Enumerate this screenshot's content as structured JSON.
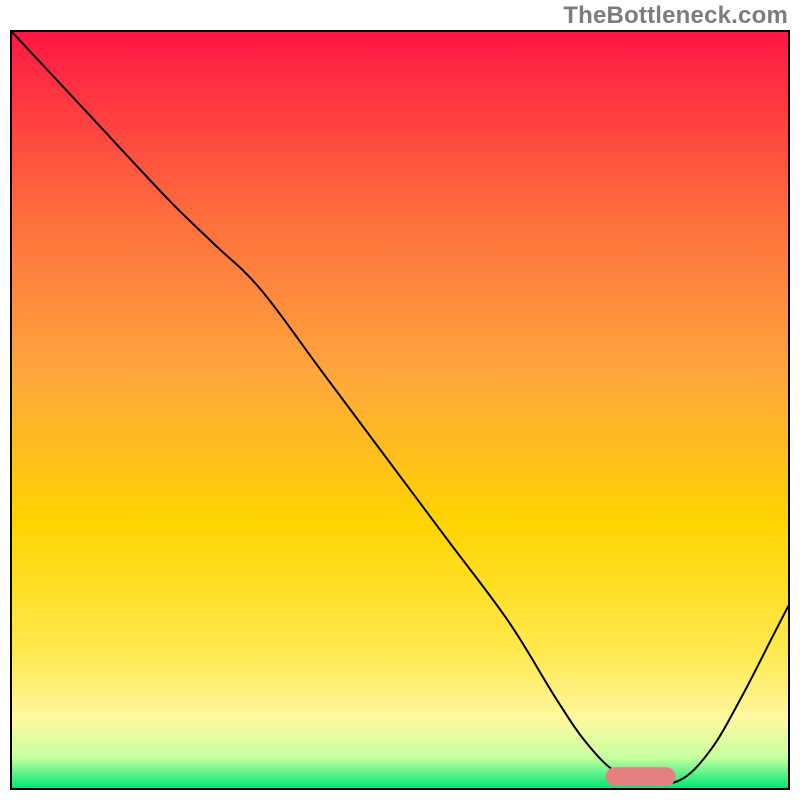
{
  "watermark": "TheBottleneck.com",
  "chart_data": {
    "type": "line",
    "title": "",
    "xlabel": "",
    "ylabel": "",
    "xlim": [
      0,
      100
    ],
    "ylim": [
      0,
      100
    ],
    "grid": false,
    "colors": {
      "gradient_top": "#ff1744",
      "gradient_mid_upper": "#ff8a3d",
      "gradient_mid": "#ffd400",
      "gradient_lower": "#fff8a0",
      "gradient_bottom": "#00e676",
      "curve": "#000000",
      "marker": "#e58080"
    },
    "series": [
      {
        "name": "bottleneck-curve",
        "x": [
          0,
          10,
          20,
          26,
          32,
          40,
          48,
          56,
          64,
          70,
          74,
          78,
          82,
          86,
          90,
          94,
          98,
          100
        ],
        "y": [
          100,
          89,
          78,
          72,
          66,
          55,
          44,
          33,
          22,
          12,
          6,
          2,
          1,
          1,
          5,
          12,
          20,
          24
        ]
      }
    ],
    "marker": {
      "x_center": 81,
      "y": 1.5,
      "width": 9,
      "height": 2.5
    },
    "legend": []
  }
}
